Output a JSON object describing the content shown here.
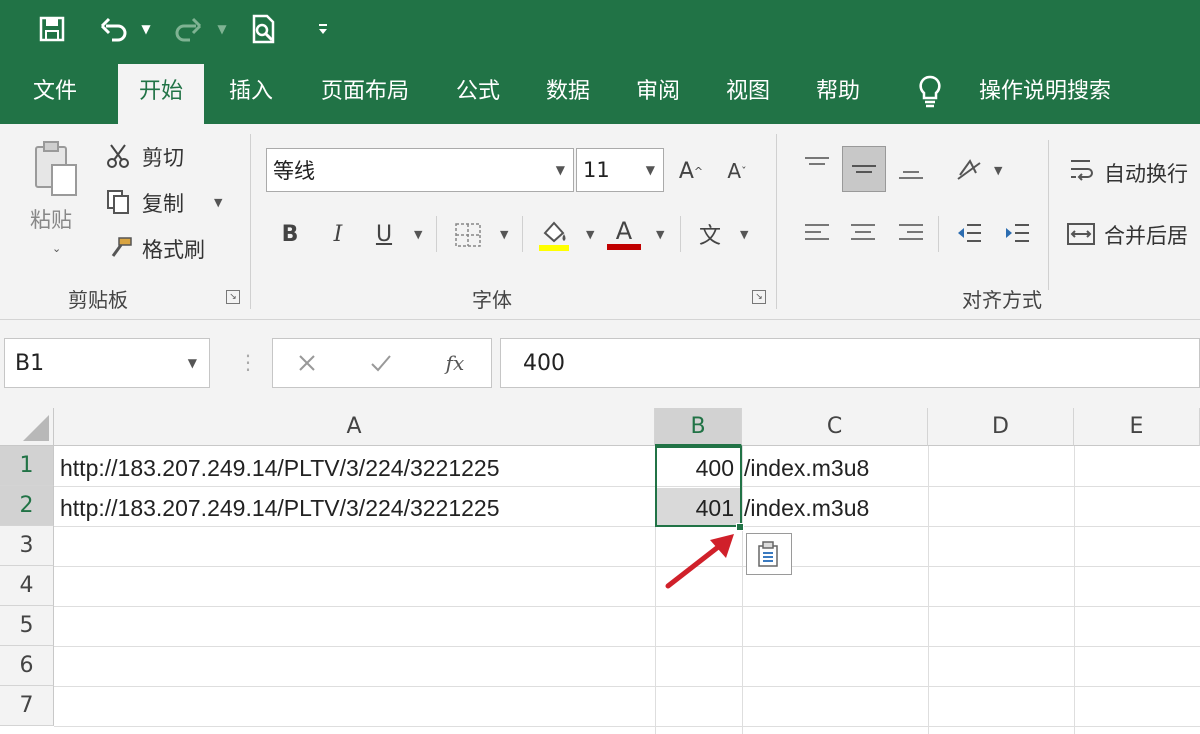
{
  "quick_access": {
    "save_icon": "save-icon",
    "undo_icon": "undo-icon",
    "redo_icon": "redo-icon",
    "print_preview_icon": "print-preview-icon",
    "customize_icon": "customize-qat-icon"
  },
  "tabs": [
    {
      "label": "文件"
    },
    {
      "label": "开始"
    },
    {
      "label": "插入"
    },
    {
      "label": "页面布局"
    },
    {
      "label": "公式"
    },
    {
      "label": "数据"
    },
    {
      "label": "审阅"
    },
    {
      "label": "视图"
    },
    {
      "label": "帮助"
    }
  ],
  "tell_me": "操作说明搜索",
  "clipboard": {
    "paste": "粘贴",
    "cut": "剪切",
    "copy": "复制",
    "format_painter": "格式刷",
    "group_label": "剪贴板"
  },
  "font": {
    "name": "等线",
    "size": "11",
    "bold": "B",
    "italic": "I",
    "underline": "U",
    "font_color_letter": "A",
    "grow_letter": "A",
    "shrink_letter": "A",
    "phonetic": "文",
    "group_label": "字体"
  },
  "alignment": {
    "wrap_text": "自动换行",
    "merge_center": "合并后居",
    "group_label": "对齐方式"
  },
  "formula_bar": {
    "name_box": "B1",
    "fx": "fx",
    "formula": "400"
  },
  "sheet": {
    "columns": [
      "A",
      "B",
      "C",
      "D",
      "E"
    ],
    "rows": [
      "1",
      "2",
      "3",
      "4",
      "5",
      "6",
      "7"
    ],
    "cells": {
      "A1": "http://183.207.249.14/PLTV/3/224/3221225",
      "B1": "400",
      "C1": "/index.m3u8",
      "A2": "http://183.207.249.14/PLTV/3/224/3221225",
      "B2": "401",
      "C2": "/index.m3u8"
    }
  },
  "colors": {
    "accent": "#217346",
    "annotation_arrow": "#d0202a",
    "fill_highlight": "#ffff00",
    "font_color_bar": "#c00000"
  }
}
